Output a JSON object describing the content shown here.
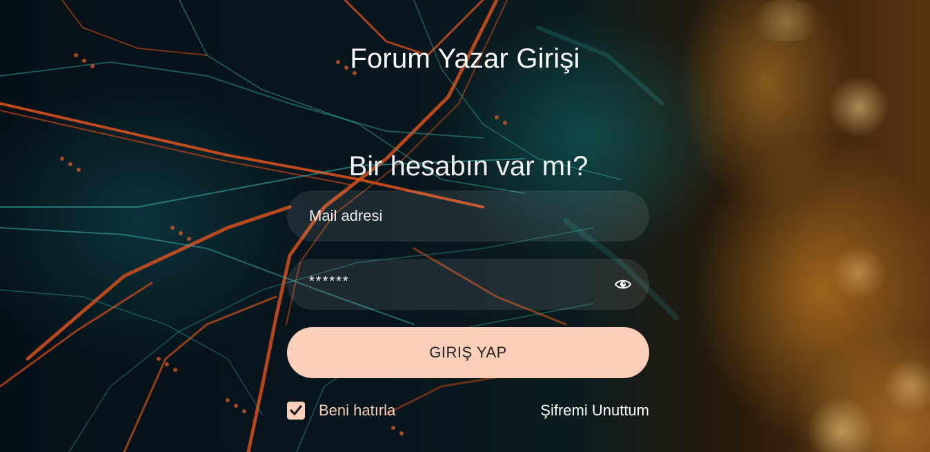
{
  "page": {
    "title": "Forum Yazar Girişi",
    "subtitle": "Bir hesabın var mı?"
  },
  "form": {
    "email_placeholder": "Mail adresi",
    "email_value": "",
    "password_value": "******",
    "password_placeholder": "",
    "submit_label": "GIRIŞ YAP",
    "remember_label": "Beni hatırla",
    "remember_checked": true,
    "forgot_label": "Şifremi Unuttum"
  },
  "icons": {
    "password_toggle": "eye-icon",
    "checkbox": "checkmark-icon"
  },
  "colors": {
    "accent": "#fbcfb9",
    "button_text": "#222222",
    "text": "#ffffff"
  }
}
